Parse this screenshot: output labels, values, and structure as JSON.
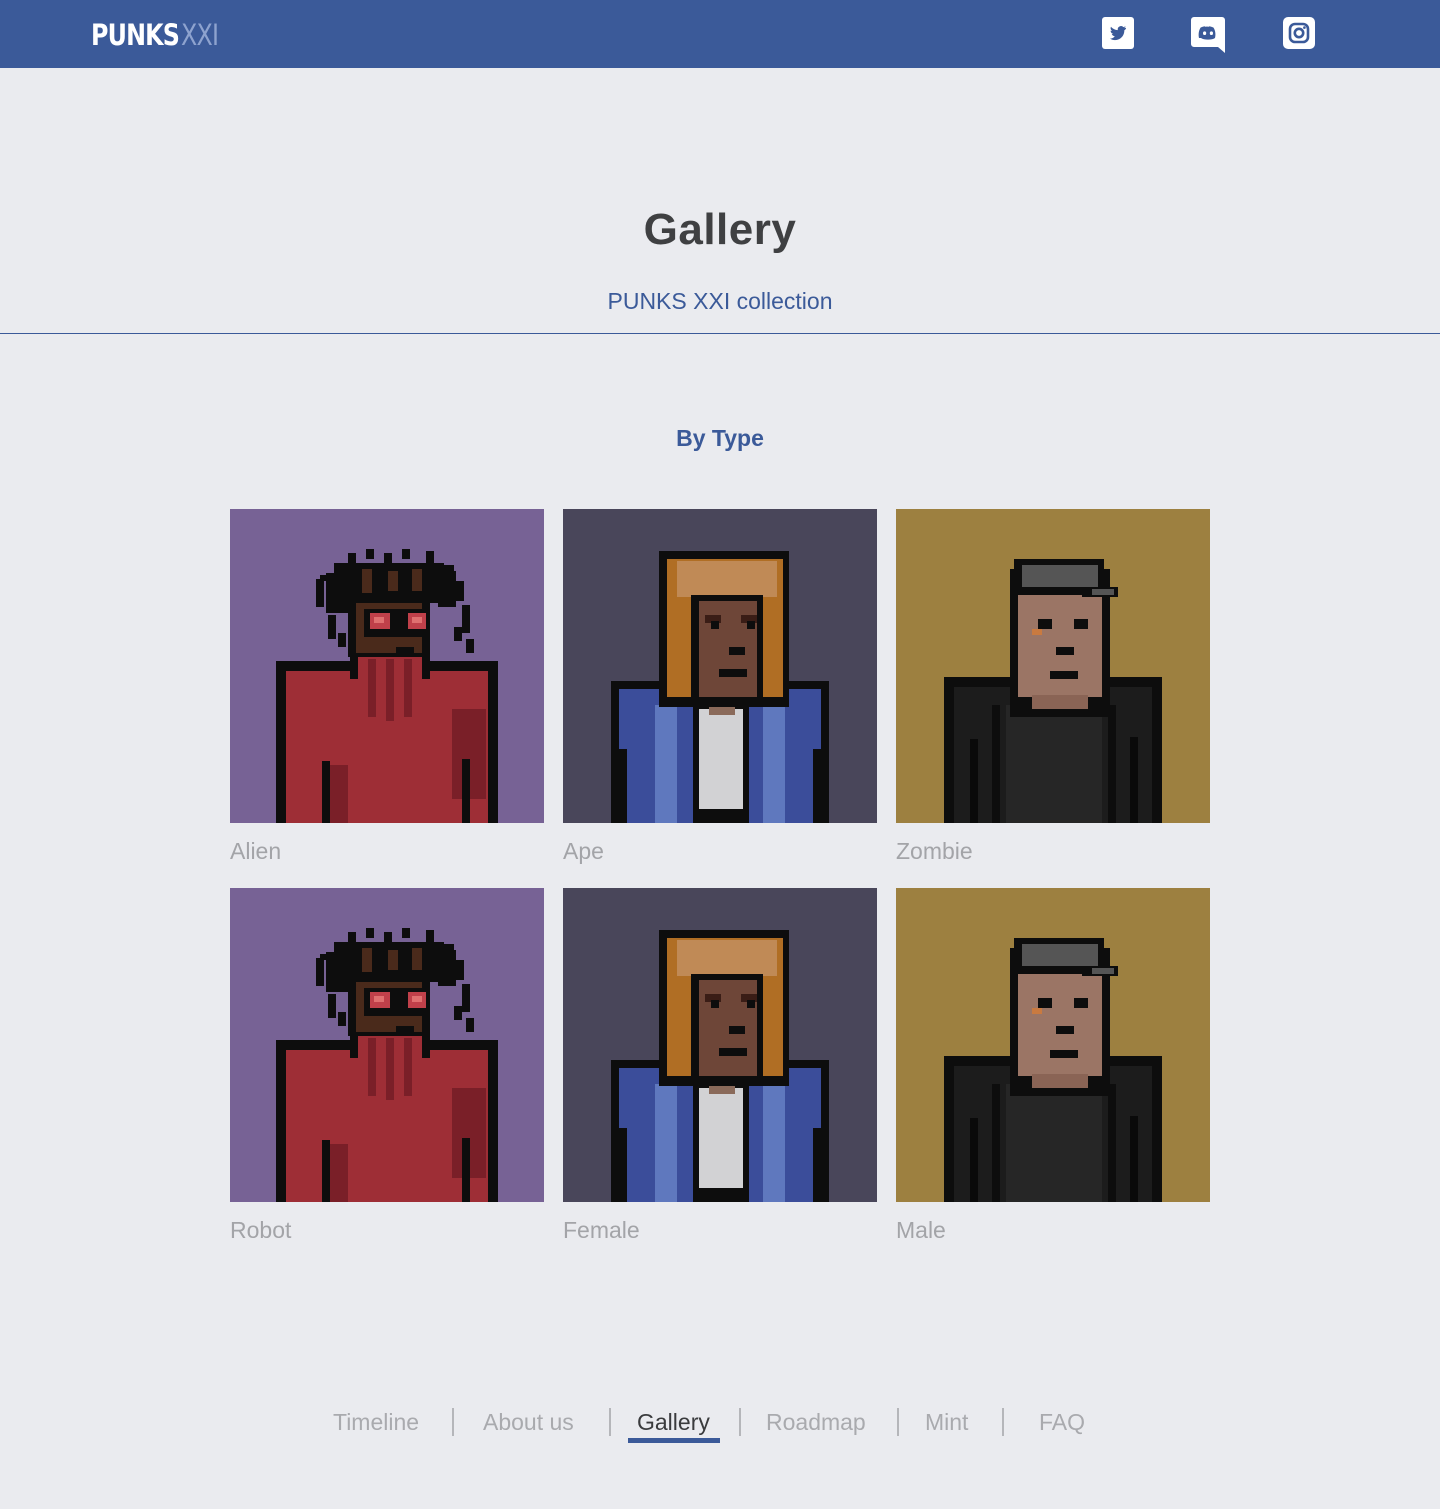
{
  "brand": {
    "name_bold": "PUNKS",
    "name_light": "XXI",
    "color": "#3b5a99"
  },
  "social": [
    {
      "name": "twitter-icon"
    },
    {
      "name": "discord-icon"
    },
    {
      "name": "instagram-icon"
    }
  ],
  "header": {
    "title": "Gallery",
    "subtitle": "PUNKS XXI collection"
  },
  "section": {
    "title": "By Type",
    "items": [
      {
        "label": "Alien",
        "art": "punk-dreads",
        "bg": "#776295"
      },
      {
        "label": "Ape",
        "art": "punk-hood",
        "bg": "#49465a"
      },
      {
        "label": "Zombie",
        "art": "punk-cap",
        "bg": "#9d8040"
      },
      {
        "label": "Robot",
        "art": "punk-dreads",
        "bg": "#776295"
      },
      {
        "label": "Female",
        "art": "punk-hood",
        "bg": "#49465a"
      },
      {
        "label": "Male",
        "art": "punk-cap",
        "bg": "#9d8040"
      }
    ]
  },
  "footer_nav": {
    "items": [
      "Timeline",
      "About us",
      "Gallery",
      "Roadmap",
      "Mint",
      "FAQ"
    ],
    "active": "Gallery"
  }
}
